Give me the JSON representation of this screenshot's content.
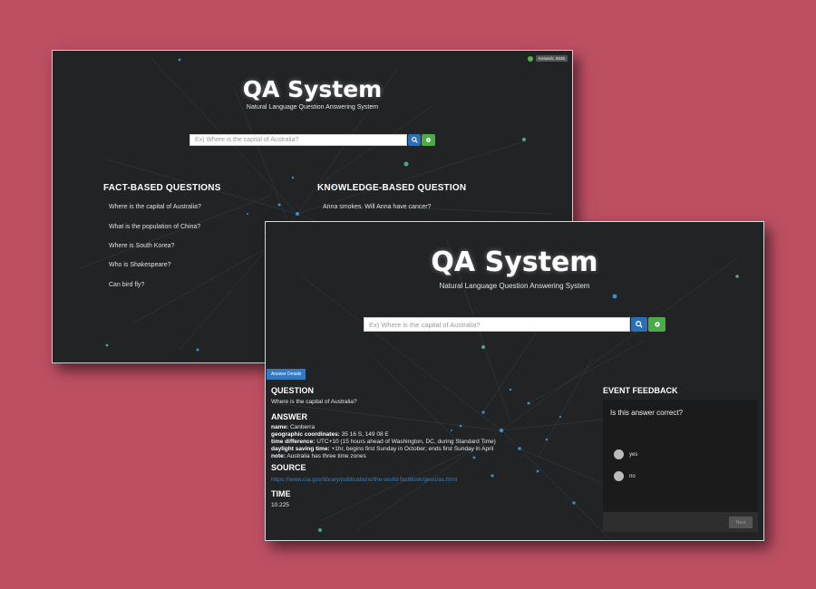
{
  "app": {
    "title": "QA System",
    "subtitle": "Natural Language Question Answering System",
    "search_placeholder": "Ex) Where is the capital of Australia?",
    "location_tag": "Keswick, 5035"
  },
  "home": {
    "fact_header": "FACT-BASED QUESTIONS",
    "fact_questions": [
      "Where is the capital of Australia?",
      "What is the population of China?",
      "Where is South Korea?",
      "Who is Shakespeare?",
      "Can bird fly?"
    ],
    "knowledge_header": "KNOWLEDGE-BASED QUESTION",
    "knowledge_questions": [
      "Anna smokes. Will Anna have cancer?"
    ]
  },
  "result": {
    "details_tab": "Answer Details",
    "question_header": "QUESTION",
    "question_text": "Where is the capital of Australia?",
    "answer_header": "ANSWER",
    "answer_fields": [
      {
        "label": "name:",
        "value": "Canberra"
      },
      {
        "label": "geographic coordinates:",
        "value": "35 16 S, 149 08 E"
      },
      {
        "label": "time difference:",
        "value": "UTC+10 (15 hours ahead of Washington, DC, during Standard Time)"
      },
      {
        "label": "daylight saving time:",
        "value": "+1hr, begins first Sunday in October; ends first Sunday in April"
      },
      {
        "label": "note:",
        "value": "Australia has three time zones"
      }
    ],
    "source_header": "SOURCE",
    "source_url": "https://www.cia.gov/library/publications/the-world-factbook/geos/as.html",
    "time_header": "TIME",
    "time_value": "10.225"
  },
  "feedback": {
    "header": "EVENT FEEDBACK",
    "question": "Is this answer correct?",
    "options": [
      "yes",
      "no"
    ],
    "next_label": "Next"
  },
  "colors": {
    "background": "#bd4f63",
    "panel": "#222325",
    "search_button": "#2d6fb7",
    "settings_button": "#4caa4a",
    "link": "#3b7fb8"
  }
}
